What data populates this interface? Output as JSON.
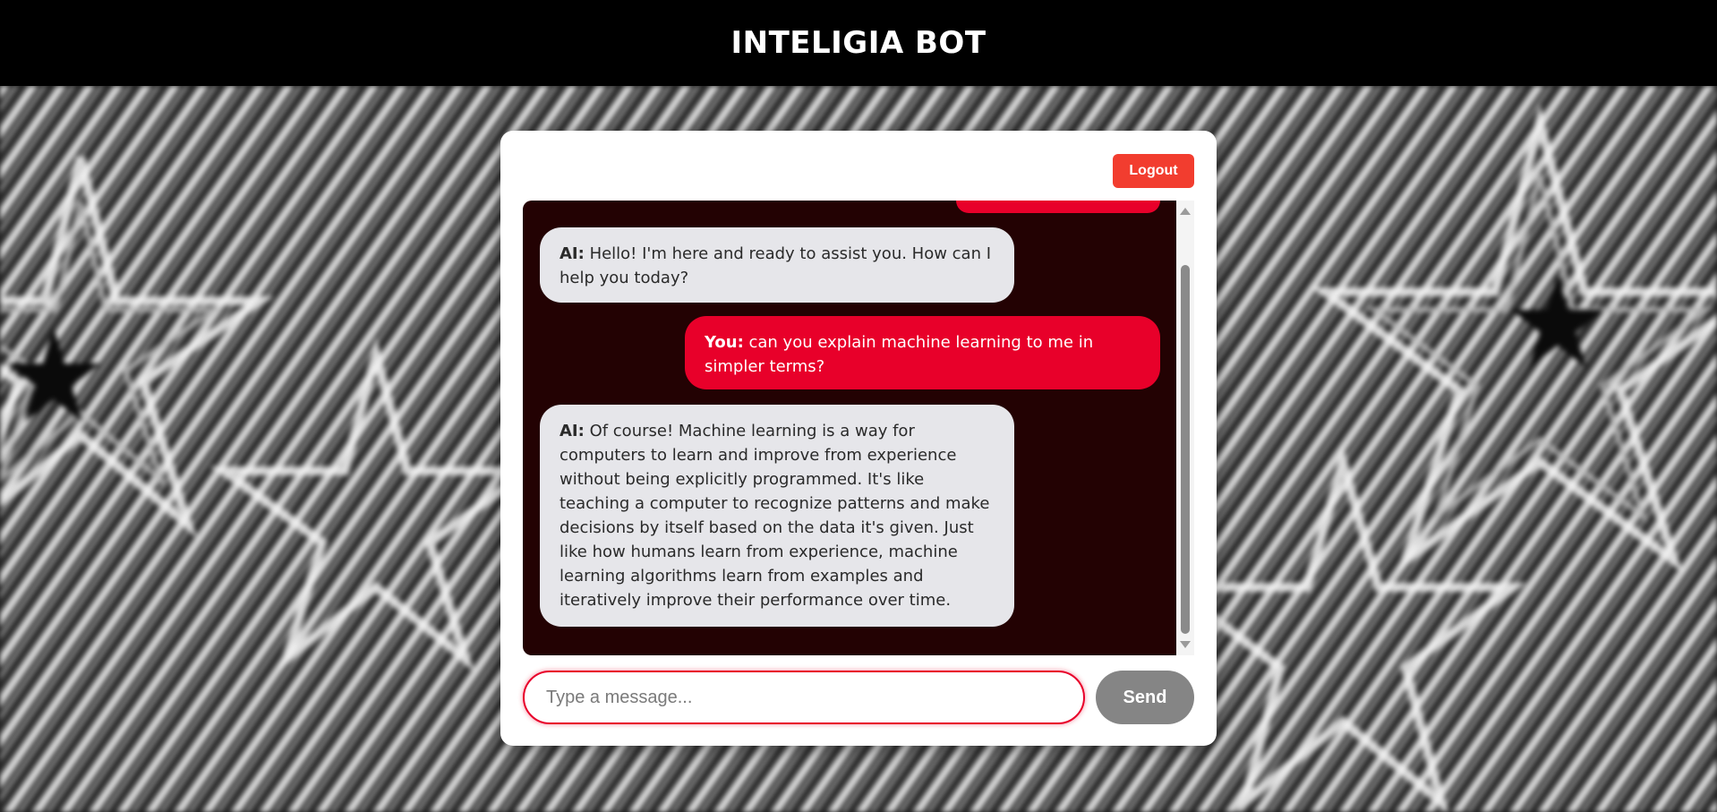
{
  "app": {
    "title": "INTELIGIA BOT"
  },
  "header": {
    "logout_label": "Logout"
  },
  "messages": [
    {
      "sender": "user",
      "speaker": "",
      "text": ""
    },
    {
      "sender": "ai",
      "speaker": "AI:",
      "text": "Hello! I'm here and ready to assist you. How can I help you today?"
    },
    {
      "sender": "user",
      "speaker": "You:",
      "text": "can you explain machine learning to me in simpler terms?"
    },
    {
      "sender": "ai",
      "speaker": "AI:",
      "text": "Of course! Machine learning is a way for computers to learn and improve from experience without being explicitly programmed. It's like teaching a computer to recognize patterns and make decisions by itself based on the data it's given. Just like how humans learn from experience, machine learning algorithms learn from examples and iteratively improve their performance over time."
    }
  ],
  "composer": {
    "placeholder": "Type a message...",
    "value": "",
    "send_label": "Send"
  },
  "colors": {
    "accent": "#e8002a",
    "logout": "#f23d2f",
    "chat_bg": "#230203",
    "ai_bubble": "#e6e6ea",
    "send": "#858585"
  },
  "icons": {
    "scroll_up": "scroll-up-arrow-icon",
    "scroll_down": "scroll-down-arrow-icon"
  }
}
